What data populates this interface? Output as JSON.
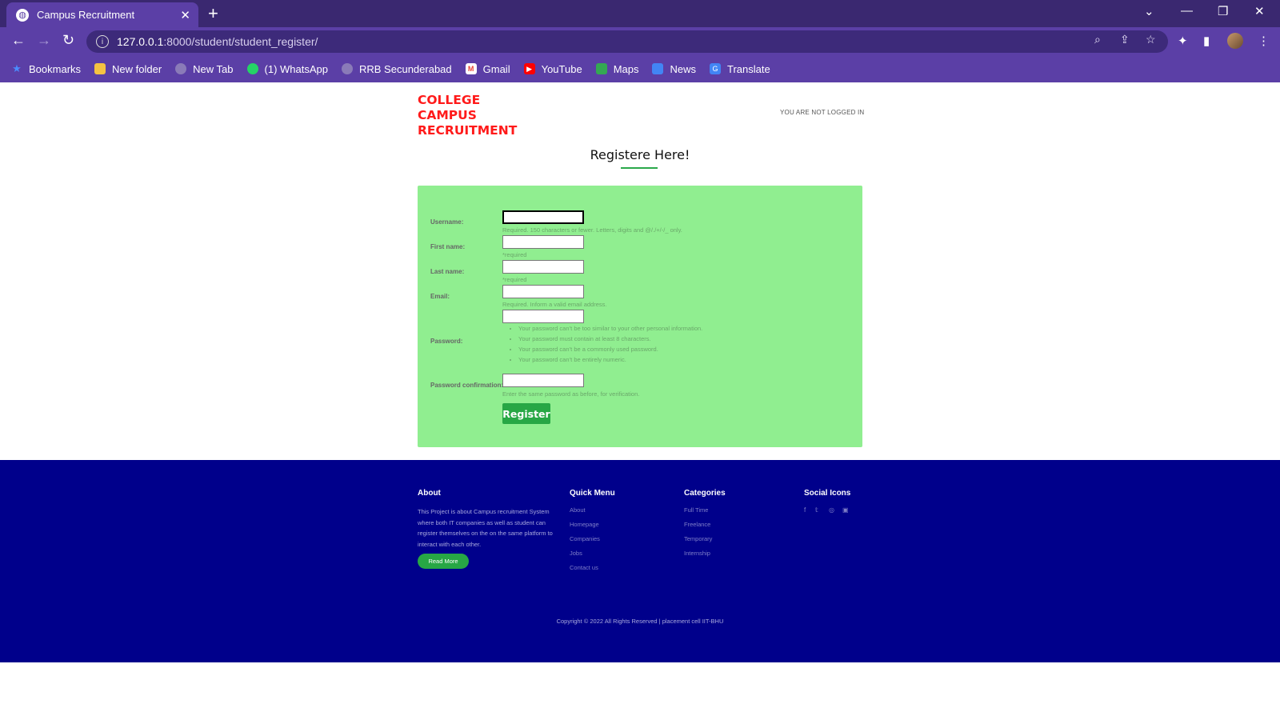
{
  "browser": {
    "tab_title": "Campus Recruitment",
    "url_host": "127.0.0.1",
    "url_rest": ":8000/student/student_register/",
    "bookmarks": [
      "Bookmarks",
      "New folder",
      "New Tab",
      "(1) WhatsApp",
      "RRB Secunderabad",
      "Gmail",
      "YouTube",
      "Maps",
      "News",
      "Translate"
    ]
  },
  "header": {
    "brand_line1": "COLLEGE",
    "brand_line2": "CAMPUS",
    "brand_line3": "RECRUITMENT",
    "login_status": "YOU ARE NOT LOGGED IN"
  },
  "form": {
    "title": "Registere Here!",
    "username_label": "Username:",
    "username_help": "Required. 150 characters or fewer. Letters, digits and @/./+/-/_ only.",
    "first_name_label": "First name:",
    "first_name_help": "*required",
    "last_name_label": "Last name:",
    "last_name_help": "*required",
    "email_label": "Email:",
    "email_help": "Required. Inform a valid email address.",
    "password_label": "Password:",
    "password_rules": [
      "Your password can’t be too similar to your other personal information.",
      "Your password must contain at least 8 characters.",
      "Your password can’t be a commonly used password.",
      "Your password can’t be entirely numeric."
    ],
    "password_confirm_label": "Password confirmation:",
    "password_confirm_help": "Enter the same password as before, for verification.",
    "submit_label": "Register"
  },
  "footer": {
    "about_title": "About",
    "about_text": "This Project is about Campus recruitment System where both IT companies as well as student can register themselves on the on the same platform to interact with each other.",
    "read_more": "Read More",
    "quick_menu_title": "Quick Menu",
    "quick_menu": [
      "About",
      "Homepage",
      "Companies",
      "Jobs",
      "Contact us"
    ],
    "categories_title": "Categories",
    "categories": [
      "Full Time",
      "Freelance",
      "Temporary",
      "Internship"
    ],
    "social_title": "Social Icons",
    "copyright": "Copyright © 2022 All Rights Reserved | placement cell IIT-BHU"
  },
  "colors": {
    "brand_red": "#ff1a1a",
    "form_bg": "#90ee90",
    "button_green": "#27a745",
    "footer_bg": "#00008b",
    "chrome_purple": "#5b3fa6"
  }
}
